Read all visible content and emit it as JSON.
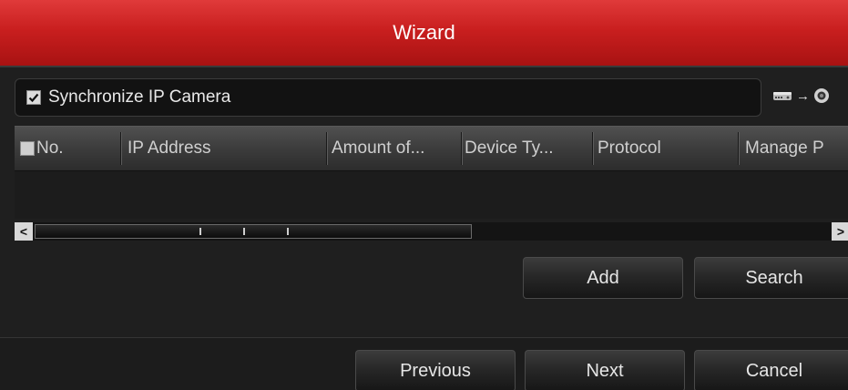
{
  "window": {
    "title": "Wizard"
  },
  "sync": {
    "label": "Synchronize IP Camera",
    "checked": true
  },
  "status_icons": [
    "hdd-icon",
    "arrow-right-icon",
    "camera-icon"
  ],
  "table": {
    "select_all_checked": false,
    "columns": [
      "No.",
      "IP Address",
      "Amount of...",
      "Device Ty...",
      "Protocol",
      "Manage P"
    ],
    "rows": []
  },
  "actions": {
    "add": "Add",
    "search": "Search"
  },
  "footer": {
    "previous": "Previous",
    "next": "Next",
    "cancel": "Cancel"
  },
  "colors": {
    "title_bar": "#c91f1f",
    "background": "#1f1f1f"
  }
}
